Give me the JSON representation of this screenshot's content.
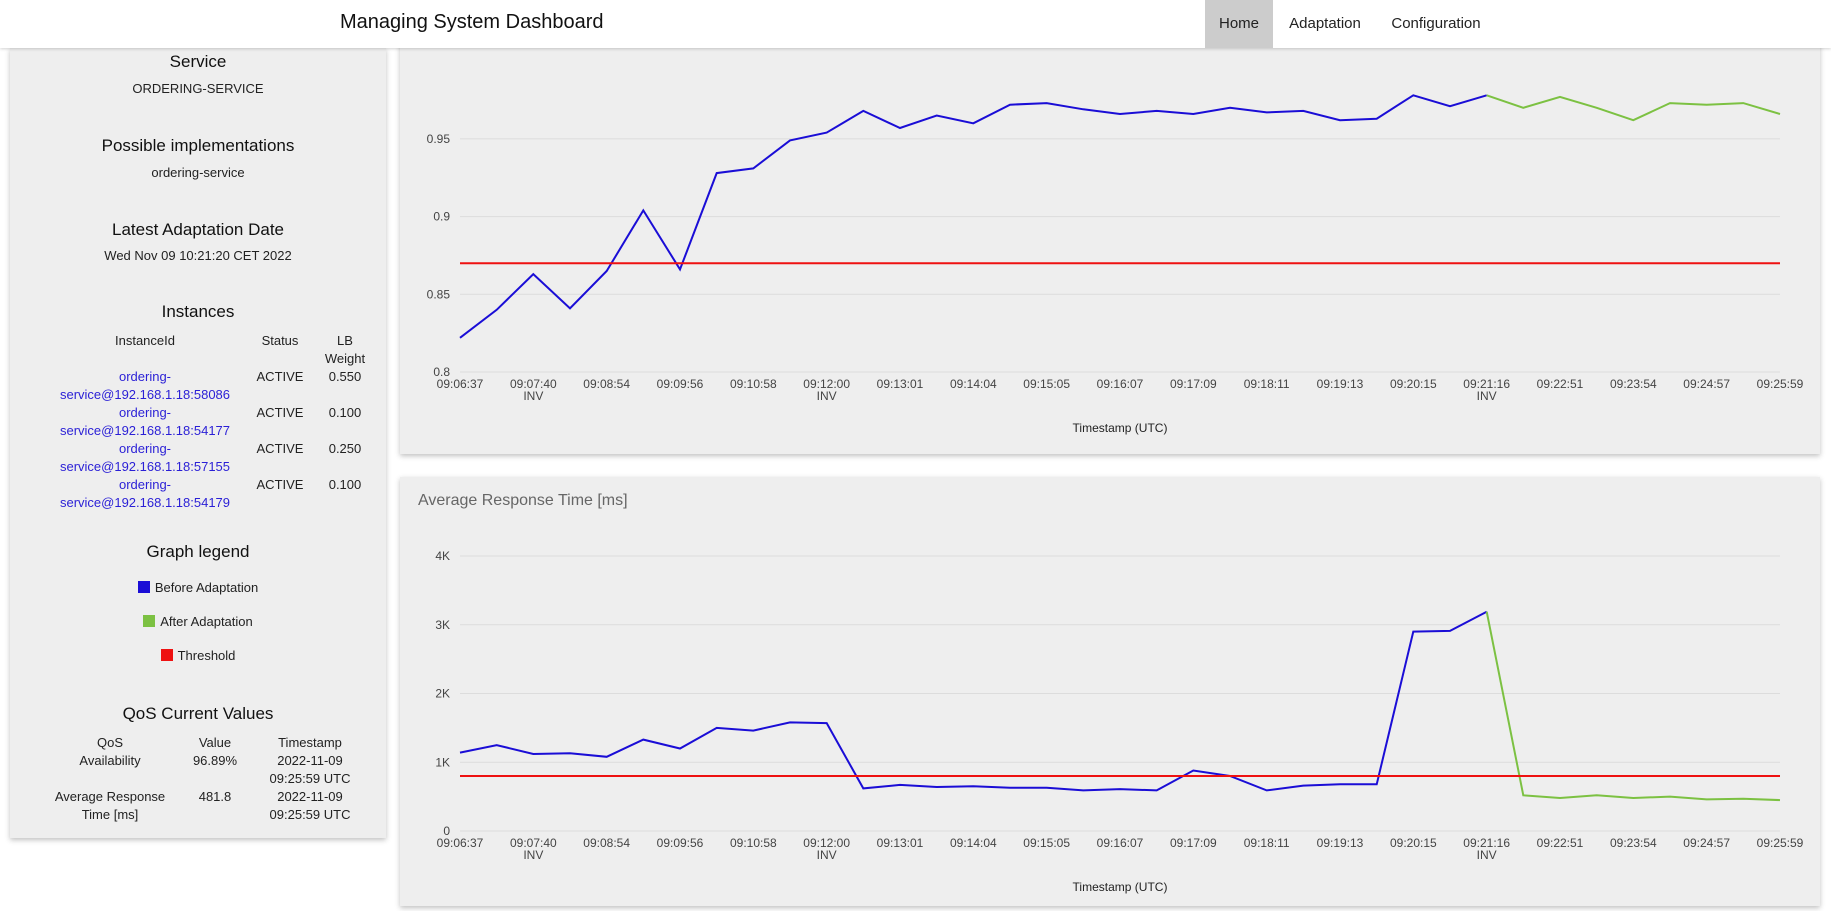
{
  "navbar": {
    "brand": "Managing System Dashboard",
    "items": [
      {
        "label": "Home",
        "active": true
      },
      {
        "label": "Adaptation",
        "active": false
      },
      {
        "label": "Configuration",
        "active": false
      }
    ]
  },
  "sidebar": {
    "service": {
      "title": "Service",
      "value": "ORDERING-SERVICE"
    },
    "implementations": {
      "title": "Possible implementations",
      "value": "ordering-service"
    },
    "adaptation_date": {
      "title": "Latest Adaptation Date",
      "value": "Wed Nov 09 10:21:20 CET 2022"
    },
    "instances": {
      "title": "Instances",
      "headers": {
        "id": "InstanceId",
        "status": "Status",
        "weight_1": "LB",
        "weight_2": "Weight"
      },
      "rows": [
        {
          "id_1": "ordering-",
          "id_2": "service@192.168.1.18:58086",
          "status": "ACTIVE",
          "weight": "0.550"
        },
        {
          "id_1": "ordering-",
          "id_2": "service@192.168.1.18:54177",
          "status": "ACTIVE",
          "weight": "0.100"
        },
        {
          "id_1": "ordering-",
          "id_2": "service@192.168.1.18:57155",
          "status": "ACTIVE",
          "weight": "0.250"
        },
        {
          "id_1": "ordering-",
          "id_2": "service@192.168.1.18:54179",
          "status": "ACTIVE",
          "weight": "0.100"
        }
      ]
    },
    "legend": {
      "title": "Graph legend",
      "items": [
        {
          "label": "Before Adaptation",
          "color": "#1a0dd6"
        },
        {
          "label": "After Adaptation",
          "color": "#7cc142"
        },
        {
          "label": "Threshold",
          "color": "#ee1111"
        }
      ]
    },
    "qos": {
      "title": "QoS Current Values",
      "headers": {
        "qos": "QoS",
        "value": "Value",
        "timestamp": "Timestamp"
      },
      "rows": [
        {
          "qos_1": "Availability",
          "qos_2": "",
          "value": "96.89%",
          "ts_1": "2022-11-09",
          "ts_2": "09:25:59 UTC"
        },
        {
          "qos_1": "Average Response",
          "qos_2": "Time [ms]",
          "value": "481.8",
          "ts_1": "2022-11-09",
          "ts_2": "09:25:59 UTC"
        }
      ]
    }
  },
  "chart_data": [
    {
      "type": "line",
      "title": "",
      "xlabel": "Timestamp (UTC)",
      "ylabel": "",
      "ylim": [
        0.8,
        0.975
      ],
      "yticks": [
        "0.8",
        "0.85",
        "0.9",
        "0.95"
      ],
      "ytick_values": [
        0.8,
        0.85,
        0.9,
        0.95
      ],
      "xticks": [
        "09:06:37",
        "09:07:40",
        "09:08:54",
        "09:09:56",
        "09:10:58",
        "09:12:00",
        "09:13:01",
        "09:14:04",
        "09:15:05",
        "09:16:07",
        "09:17:09",
        "09:18:11",
        "09:19:13",
        "09:20:15",
        "09:21:16",
        "09:22:51",
        "09:23:54",
        "09:24:57",
        "09:25:59"
      ],
      "xtick_sublabels": {
        "1": "INV",
        "5": "INV",
        "14": "INV"
      },
      "series": [
        {
          "color": "#1a0dd6",
          "start": 0,
          "values": [
            0.822,
            0.84,
            0.863,
            0.841,
            0.865,
            0.904,
            0.866,
            0.928,
            0.931,
            0.949,
            0.954,
            0.968,
            0.957,
            0.965,
            0.96,
            0.972,
            0.973,
            0.969,
            0.966,
            0.968,
            0.966,
            0.97,
            0.967,
            0.968,
            0.962,
            0.963,
            0.978,
            0.971,
            0.978
          ]
        },
        {
          "color": "#7cc142",
          "start": 28,
          "values": [
            0.978,
            0.97,
            0.977,
            0.97,
            0.962,
            0.973,
            0.972,
            0.973,
            0.966
          ]
        },
        {
          "color": "#ee1111",
          "start": 0,
          "values": [
            0.87,
            0.87
          ]
        }
      ]
    },
    {
      "type": "line",
      "title": "Average Response Time [ms]",
      "xlabel": "Timestamp (UTC)",
      "ylabel": "",
      "ylim": [
        0,
        4000
      ],
      "yticks": [
        "0",
        "1K",
        "2K",
        "3K",
        "4K"
      ],
      "ytick_values": [
        0,
        1000,
        2000,
        3000,
        4000
      ],
      "xticks": [
        "09:06:37",
        "09:07:40",
        "09:08:54",
        "09:09:56",
        "09:10:58",
        "09:12:00",
        "09:13:01",
        "09:14:04",
        "09:15:05",
        "09:16:07",
        "09:17:09",
        "09:18:11",
        "09:19:13",
        "09:20:15",
        "09:21:16",
        "09:22:51",
        "09:23:54",
        "09:24:57",
        "09:25:59"
      ],
      "xtick_sublabels": {
        "1": "INV",
        "5": "INV",
        "14": "INV"
      },
      "series": [
        {
          "color": "#1a0dd6",
          "start": 0,
          "values": [
            1140,
            1250,
            1120,
            1130,
            1080,
            1330,
            1200,
            1500,
            1460,
            1580,
            1570,
            620,
            670,
            640,
            650,
            630,
            630,
            590,
            610,
            590,
            880,
            800,
            590,
            660,
            680,
            680,
            2900,
            2910,
            3190
          ]
        },
        {
          "color": "#7cc142",
          "start": 28,
          "values": [
            3190,
            520,
            480,
            520,
            480,
            500,
            460,
            470,
            450
          ]
        },
        {
          "color": "#ee1111",
          "start": 0,
          "values": [
            800,
            800
          ]
        }
      ]
    }
  ]
}
